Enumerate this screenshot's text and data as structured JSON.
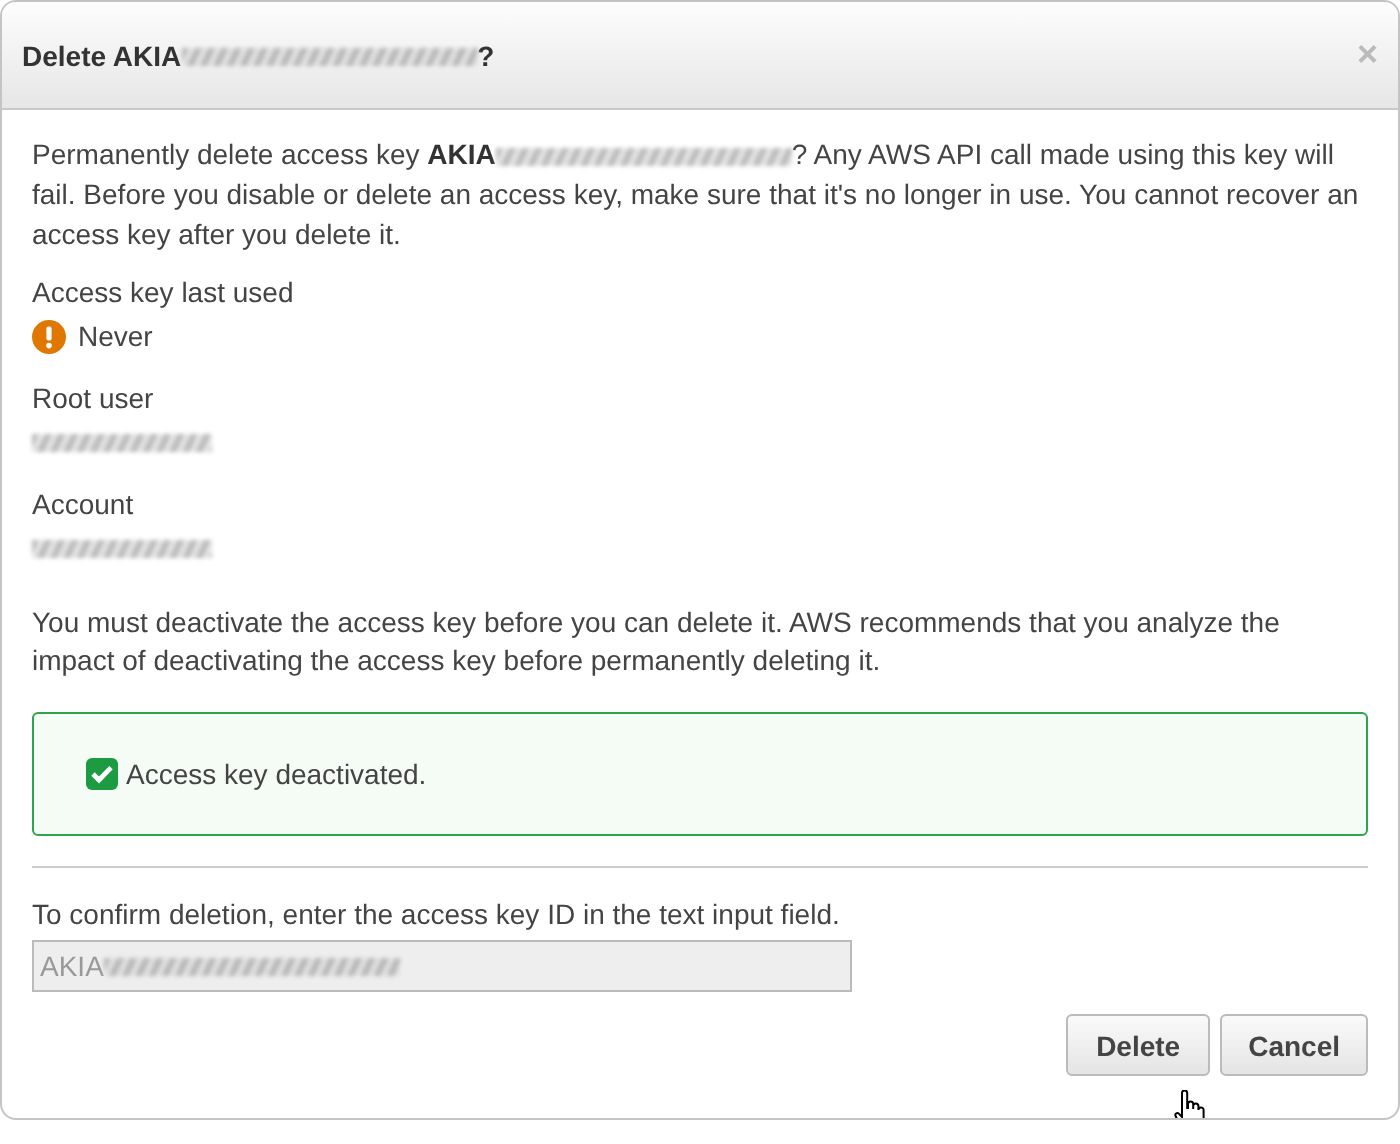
{
  "dialog": {
    "title": {
      "before": "Delete AKIA",
      "redacted": true,
      "after": "?"
    },
    "close": "×"
  },
  "warning": {
    "before": "Permanently delete access key **AKIA**",
    "redacted": true,
    "after": "? Any AWS API call made using this key will fail. Before you disable or delete an access key, make sure that it's no longer in use. You cannot recover an access key after you delete it."
  },
  "fields": [
    {
      "label": "Access key last used",
      "kind": "status",
      "value": "Never"
    },
    {
      "label": "Root user",
      "kind": "redacted"
    },
    {
      "label": "Account",
      "kind": "redacted"
    }
  ],
  "notice": "You must deactivate the access key before you can delete it. AWS recommends that you analyze the impact of deactivating the access key before permanently deleting it.",
  "deactivate": {
    "label": "Access key deactivated.",
    "checked": true
  },
  "confirm": {
    "label": "To confirm deletion, enter the access key ID in the text input field.",
    "value": "AKIA",
    "redacted": true,
    "disabled": true
  },
  "buttons": [
    "Delete",
    "Cancel"
  ]
}
